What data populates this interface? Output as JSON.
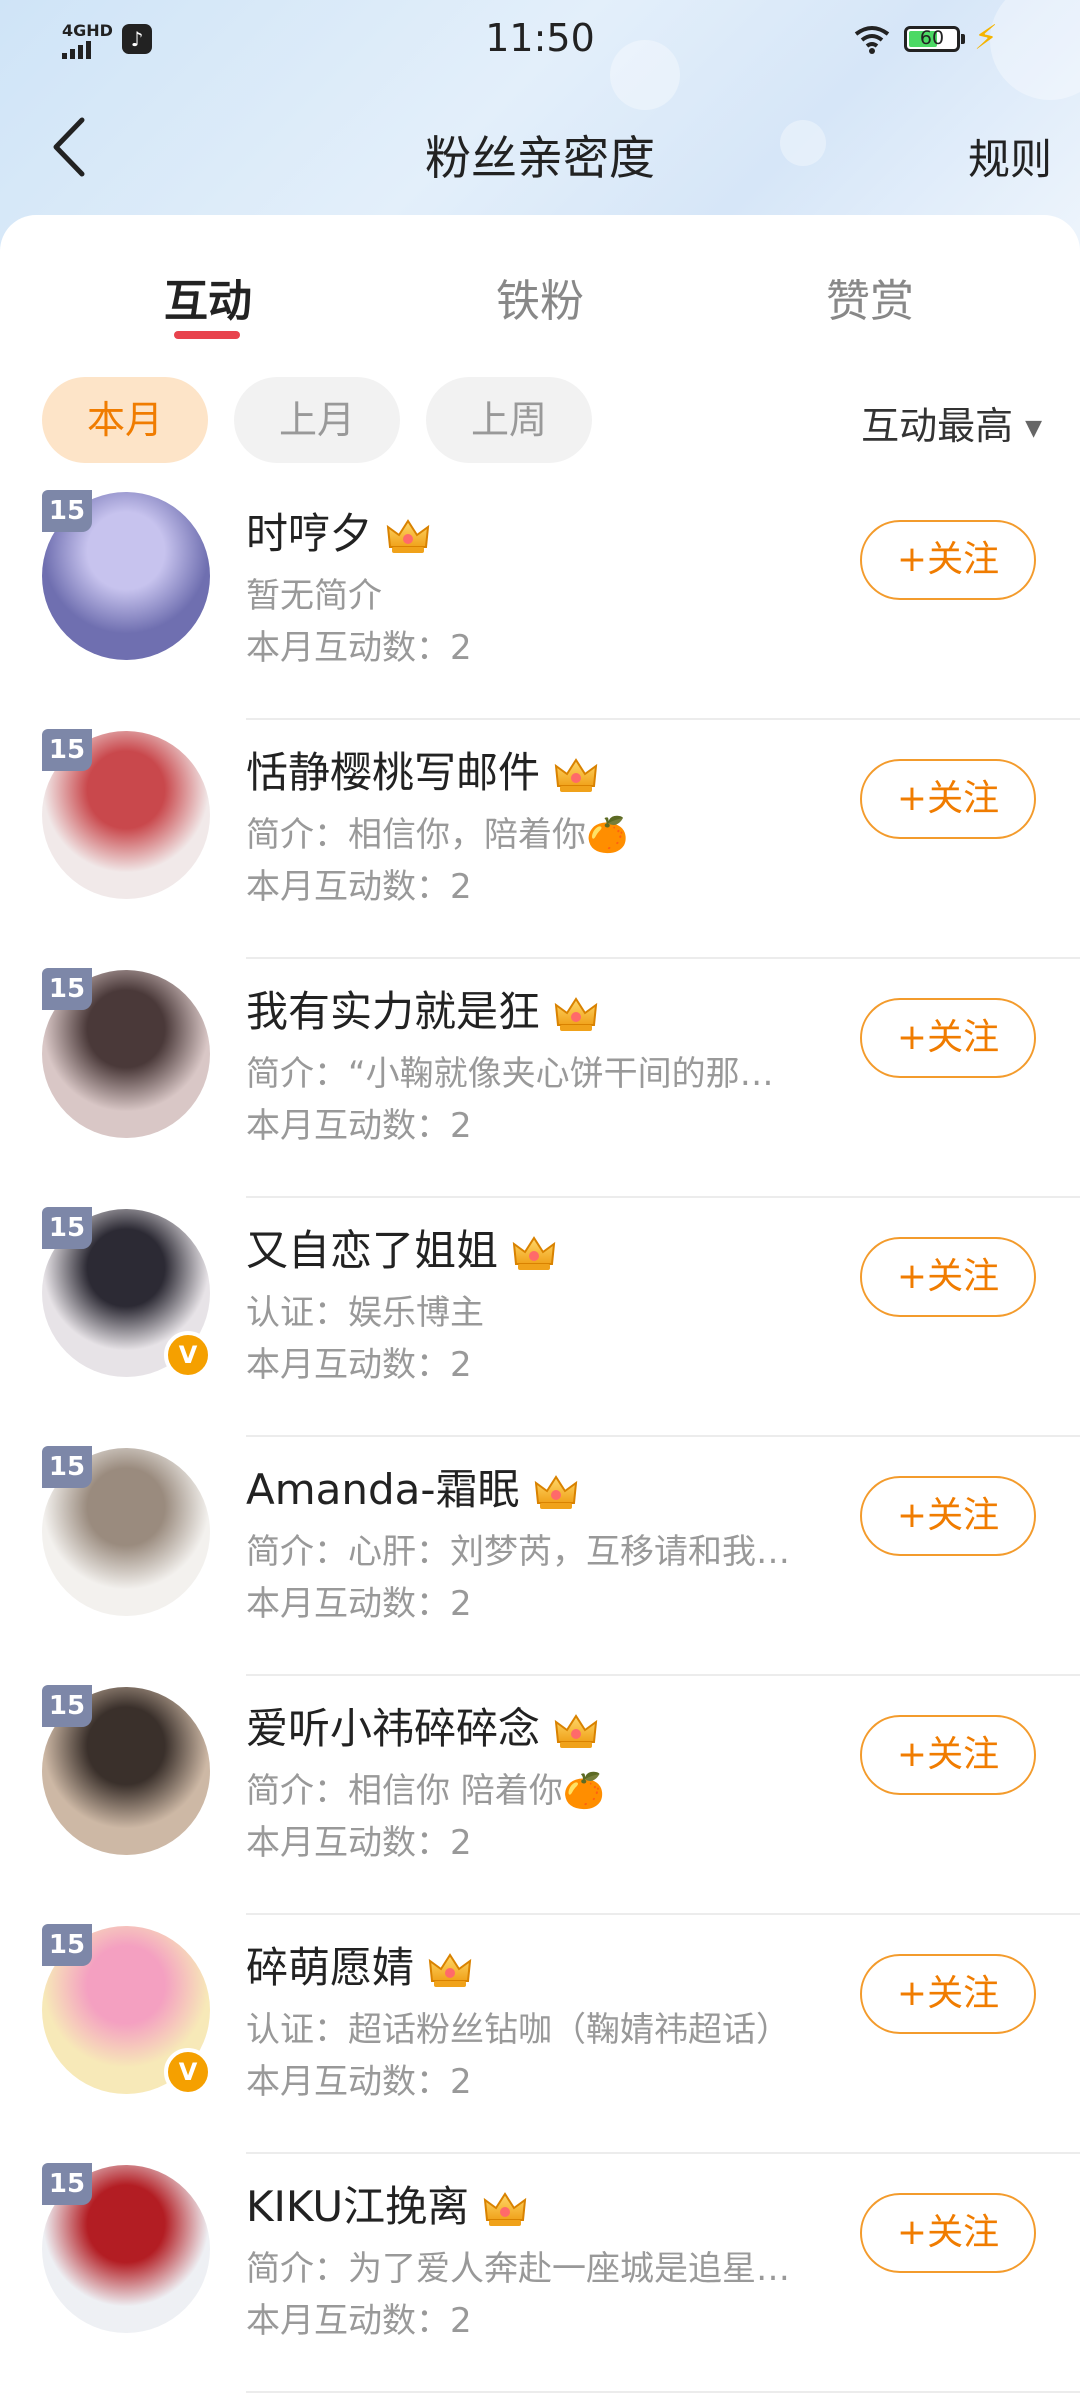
{
  "status_bar": {
    "network": "4GHD",
    "time": "11:50",
    "battery": "60",
    "battery_level": 0.6
  },
  "nav": {
    "title": "粉丝亲密度",
    "rules": "规则"
  },
  "tabs": [
    {
      "label": "互动",
      "active": true
    },
    {
      "label": "铁粉",
      "active": false
    },
    {
      "label": "赞赏",
      "active": false
    }
  ],
  "filters": [
    {
      "label": "本月",
      "active": true
    },
    {
      "label": "上月",
      "active": false
    },
    {
      "label": "上周",
      "active": false
    }
  ],
  "sort": {
    "label": "互动最高"
  },
  "follow_label": "+关注",
  "fans": [
    {
      "name": "时哼夕",
      "level": "15",
      "bio": "暂无简介",
      "count": "本月互动数：2",
      "verified": false,
      "colors": [
        "#6f6fb0",
        "#c7c3ee"
      ]
    },
    {
      "name": "恬静樱桃写邮件",
      "level": "15",
      "bio": "简介：相信你，陪着你🍊",
      "count": "本月互动数：2",
      "verified": false,
      "colors": [
        "#f1e9e9",
        "#c9484c"
      ]
    },
    {
      "name": "我有实力就是狂",
      "level": "15",
      "bio": "简介：“小鞠就像夹心饼干间的那…",
      "count": "本月互动数：2",
      "verified": false,
      "colors": [
        "#d9c7c6",
        "#4a3939"
      ]
    },
    {
      "name": "又自恋了姐姐",
      "level": "15",
      "bio": "认证：娱乐博主",
      "count": "本月互动数：2",
      "verified": true,
      "colors": [
        "#e7e3e7",
        "#2c2a34"
      ]
    },
    {
      "name": "Amanda-霜眠",
      "level": "15",
      "bio": "简介：心肝：刘梦芮，互移请和我…",
      "count": "本月互动数：2",
      "verified": false,
      "colors": [
        "#f3f1ee",
        "#9a8b7e"
      ]
    },
    {
      "name": "爱听小祎碎碎念",
      "level": "15",
      "bio": "简介：相信你 陪着你🍊",
      "count": "本月互动数：2",
      "verified": false,
      "colors": [
        "#cdb8a5",
        "#3a302b"
      ]
    },
    {
      "name": "碎萌愿婧",
      "level": "15",
      "bio": "认证：超话粉丝钻咖（鞠婧祎超话）",
      "count": "本月互动数：2",
      "verified": true,
      "colors": [
        "#f7e9b8",
        "#f4a0c1"
      ]
    },
    {
      "name": "KIKU江挽离",
      "level": "15",
      "bio": "简介：为了爱人奔赴一座城是追星…",
      "count": "本月互动数：2",
      "verified": false,
      "colors": [
        "#eef0f4",
        "#b31d23"
      ]
    }
  ]
}
